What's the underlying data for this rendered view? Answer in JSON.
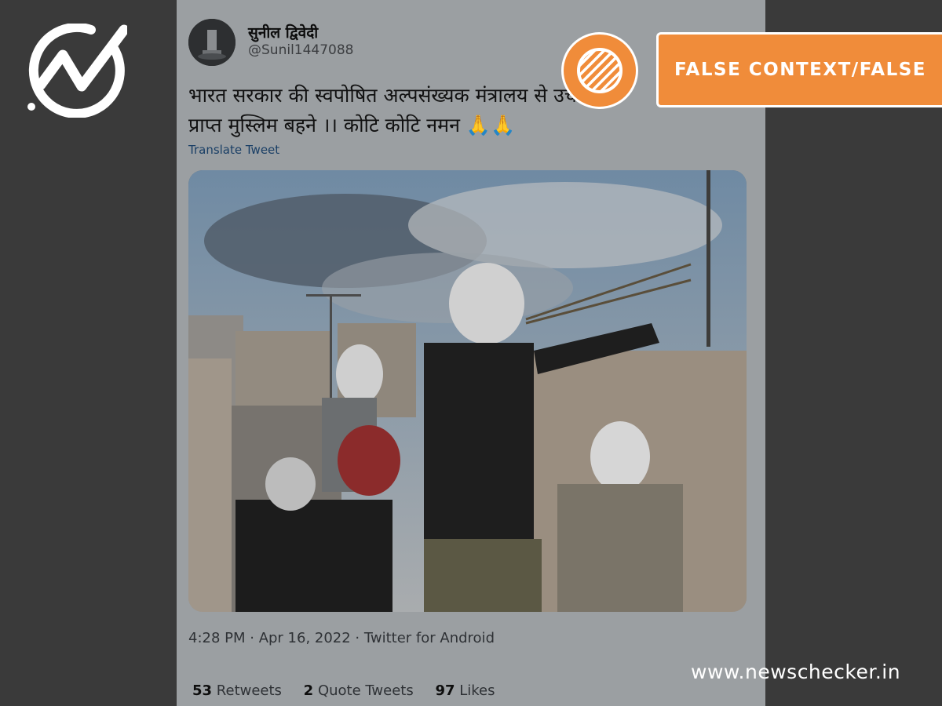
{
  "tweet": {
    "display_name": "सुनील द्विवेदी",
    "handle": "@Sunil1447088",
    "more_icon": "…",
    "text_line1": "भारत सरकार की स्वपोषित अल्पसंख्यक मंत्रालय से उच",
    "text_line2": "प्राप्त मुस्लिम बहने ।। कोटि कोटि नमन 🙏🙏",
    "translate_label": "Translate Tweet",
    "timestamp": "4:28 PM · Apr 16, 2022 · Twitter for Android",
    "stats": {
      "retweets_count": "53",
      "retweets_label": "Retweets",
      "quotes_count": "2",
      "quotes_label": "Quote Tweets",
      "likes_count": "97",
      "likes_label": "Likes"
    }
  },
  "badge": {
    "label": "FALSE CONTEXT/FALSE",
    "icon": "striped-circle-icon",
    "color": "#f08c3a"
  },
  "branding": {
    "logo_icon": "newschecker-checkmark-logo",
    "website": "www.newschecker.in"
  }
}
